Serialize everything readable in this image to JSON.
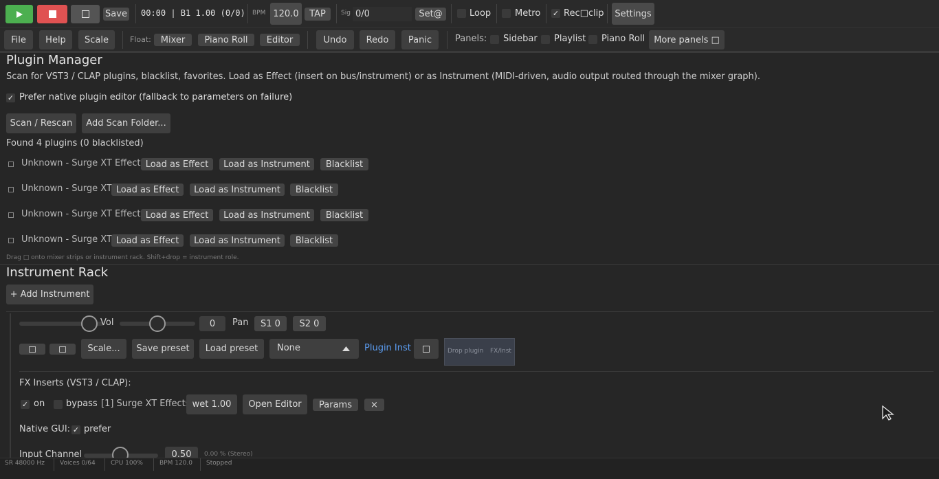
{
  "transport": {
    "play_icon": "play-icon",
    "stop_icon": "stop-icon",
    "record_icon": "record-square-icon",
    "save_label": "Save",
    "position": "00:00 | B1 1.00 (0/0)",
    "bpm_label": "BPM",
    "bpm_value": "120.0",
    "tap_label": "TAP",
    "sig_label": "Sig",
    "sig_value": "0/0",
    "setat_label": "Set@",
    "loop_label": "Loop",
    "metro_label": "Metro",
    "rec_clip_label": "Rec□clip",
    "settings_label": "Settings",
    "colors": {
      "play": "#4caf50",
      "stop": "#e05252"
    }
  },
  "toolbar": {
    "file": "File",
    "help": "Help",
    "scale": "Scale",
    "float_label": "Float:",
    "mixer": "Mixer",
    "piano_roll": "Piano Roll",
    "editor": "Editor",
    "undo": "Undo",
    "redo": "Redo",
    "panic": "Panic",
    "panels_label": "Panels:",
    "sidebar": "Sidebar",
    "playlist": "Playlist",
    "piano_roll_panel": "Piano Roll",
    "more_panels": "More panels □"
  },
  "plugin_manager": {
    "title": "Plugin Manager",
    "description": "Scan for VST3 / CLAP plugins, blacklist, favorites. Load as Effect (insert on bus/instrument) or as Instrument (MIDI-driven, audio output routed through the mixer graph).",
    "prefer_native": "Prefer native plugin editor (fallback to parameters on failure)",
    "scan_button": "Scan / Rescan",
    "add_folder_button": "Add Scan Folder...",
    "found_text": "Found 4 plugins (0 blacklisted)",
    "load_effect": "Load as Effect",
    "load_instrument": "Load as Instrument",
    "blacklist": "Blacklist",
    "plugins": [
      {
        "name": "Unknown - Surge XT Effects"
      },
      {
        "name": "Unknown - Surge XT"
      },
      {
        "name": "Unknown - Surge XT Effects"
      },
      {
        "name": "Unknown - Surge XT"
      }
    ],
    "hint": "Drag □ onto mixer strips or instrument rack. Shift+drop = instrument role."
  },
  "instrument_rack": {
    "title": "Instrument Rack",
    "add_button": "+ Add Instrument",
    "vol_label": "Vol",
    "pan_value": "0",
    "pan_label": "Pan",
    "s1": "S1 0",
    "s2": "S2 0",
    "scale_button": "Scale...",
    "save_preset": "Save preset",
    "load_preset": "Load preset",
    "preset_select": "None",
    "plugin_inst": "Plugin Inst",
    "drop_plugin": "Drop plugin",
    "fx_inst": "FX/Inst",
    "fx_header": "FX Inserts (VST3 / CLAP):",
    "fx_on": "on",
    "fx_bypass": "bypass",
    "fx_name": "[1] Surge XT Effects",
    "fx_wet": "wet 1.00",
    "open_editor": "Open Editor",
    "params": "Params",
    "close": "×",
    "native_gui": "Native GUI:",
    "prefer": "prefer",
    "input_channel": "Input Channel",
    "input_value": "0.50",
    "input_pct": "0.00 % (Stereo)",
    "vol_level": 0.82,
    "pan_level": 0.5
  },
  "status_bar": {
    "sr": "SR 48000 Hz",
    "voices": "Voices 0/64",
    "cpu": "CPU 100%",
    "bpm": "BPM 120.0",
    "state": "Stopped"
  }
}
